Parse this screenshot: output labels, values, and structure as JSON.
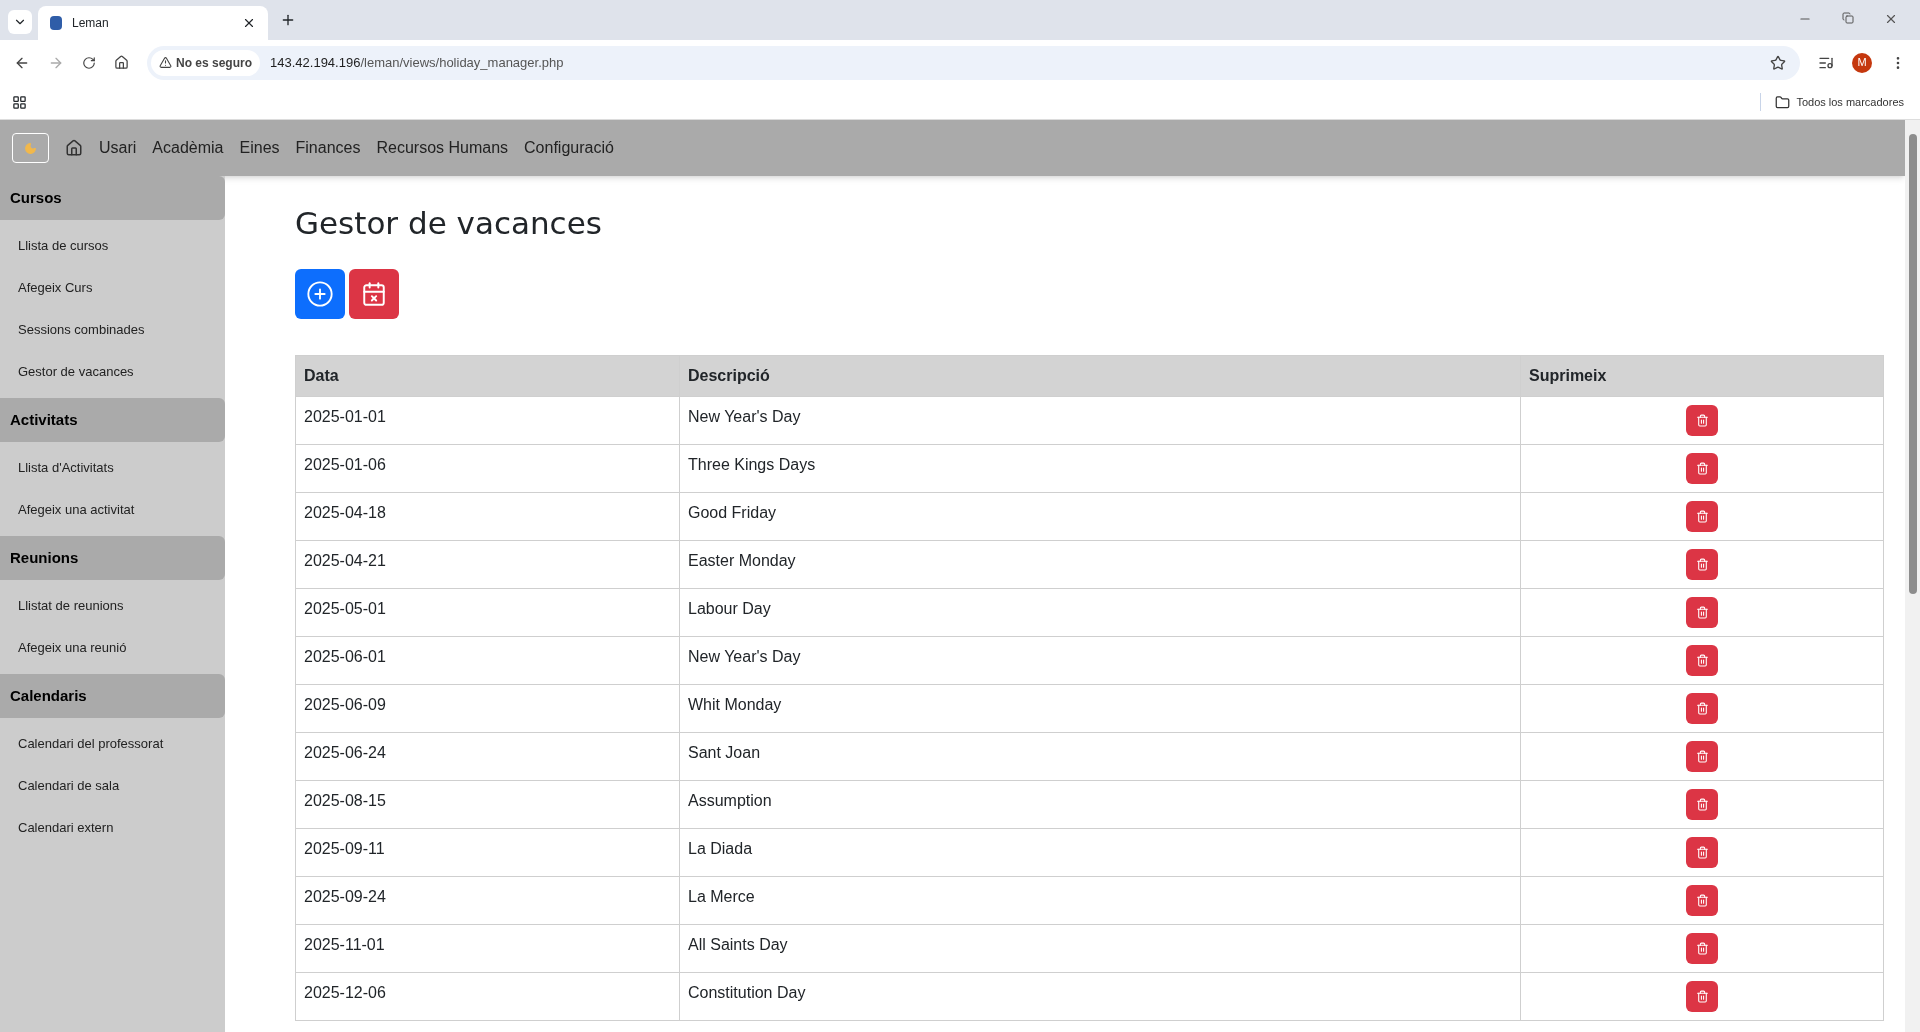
{
  "browser": {
    "tab_title": "Leman",
    "security_label": "No es seguro",
    "url_host": "143.42.194.196",
    "url_path": "/leman/views/holiday_manager.php",
    "profile_initial": "M",
    "bookmarks_label": "Todos los marcadores"
  },
  "navbar": {
    "items": [
      "Usari",
      "Acadèmia",
      "Eines",
      "Finances",
      "Recursos Humans",
      "Configuració"
    ]
  },
  "sidebar": {
    "sections": [
      {
        "title": "Cursos",
        "items": [
          "Llista de cursos",
          "Afegeix Curs",
          "Sessions combinades",
          "Gestor de vacances"
        ]
      },
      {
        "title": "Activitats",
        "items": [
          "Llista d'Activitats",
          "Afegeix una activitat"
        ]
      },
      {
        "title": "Reunions",
        "items": [
          "Llistat de reunions",
          "Afegeix una reunió"
        ]
      },
      {
        "title": "Calendaris",
        "items": [
          "Calendari del professorat",
          "Calendari de sala",
          "Calendari extern"
        ]
      }
    ]
  },
  "page": {
    "title": "Gestor de vacances"
  },
  "table": {
    "columns": [
      "Data",
      "Descripció",
      "Suprimeix"
    ],
    "rows": [
      {
        "date": "2025-01-01",
        "description": "New Year's Day"
      },
      {
        "date": "2025-01-06",
        "description": "Three Kings Days"
      },
      {
        "date": "2025-04-18",
        "description": "Good Friday"
      },
      {
        "date": "2025-04-21",
        "description": "Easter Monday"
      },
      {
        "date": "2025-05-01",
        "description": "Labour Day"
      },
      {
        "date": "2025-06-01",
        "description": "New Year's Day"
      },
      {
        "date": "2025-06-09",
        "description": "Whit Monday"
      },
      {
        "date": "2025-06-24",
        "description": "Sant Joan"
      },
      {
        "date": "2025-08-15",
        "description": "Assumption"
      },
      {
        "date": "2025-09-11",
        "description": "La Diada"
      },
      {
        "date": "2025-09-24",
        "description": "La Merce"
      },
      {
        "date": "2025-11-01",
        "description": "All Saints Day"
      },
      {
        "date": "2025-12-06",
        "description": "Constitution Day"
      }
    ]
  }
}
